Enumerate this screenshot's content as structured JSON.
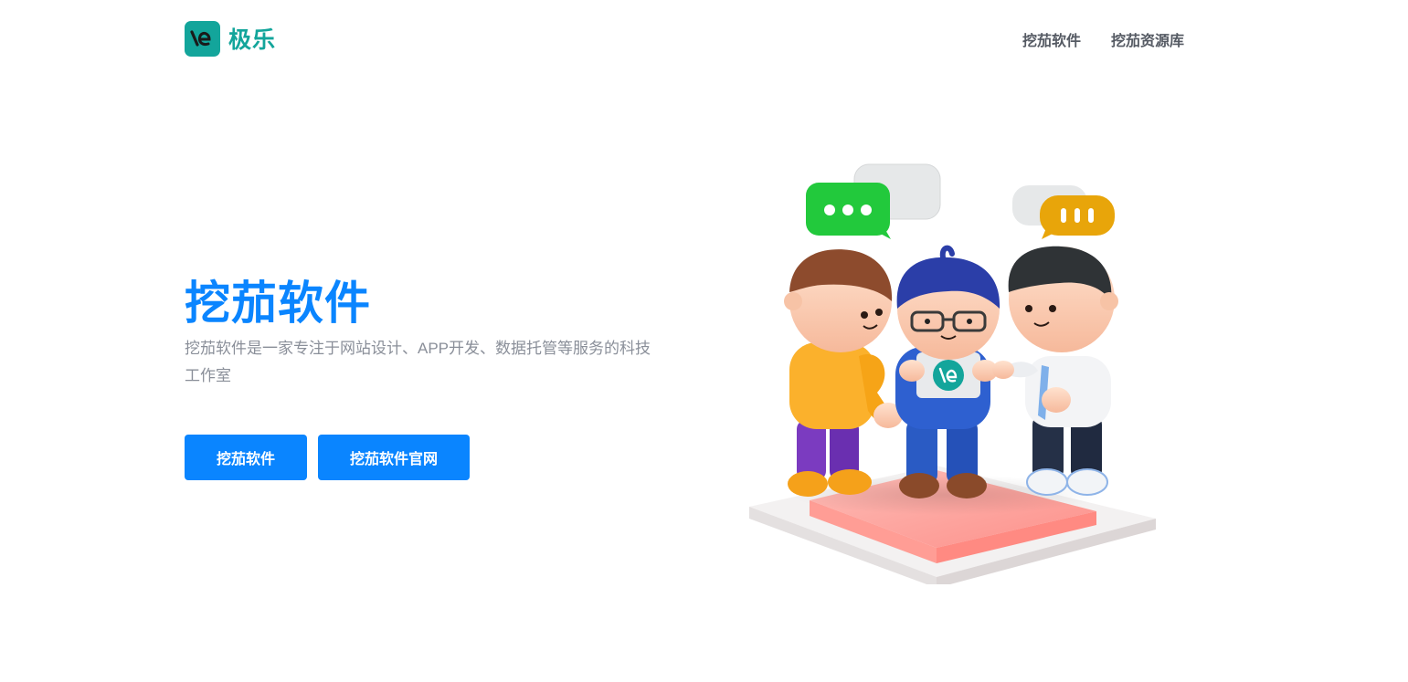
{
  "header": {
    "brand": {
      "name": "极乐",
      "logo_icon": "le-logo-icon",
      "color": "#13a59b"
    },
    "nav": [
      {
        "label": "挖茄软件"
      },
      {
        "label": "挖茄资源库"
      }
    ]
  },
  "hero": {
    "title": "挖茄软件",
    "description": "挖茄软件是一家专注于网站设计、APP开发、数据托管等服务的科技工作室",
    "buttons": [
      {
        "label": "挖茄软件"
      },
      {
        "label": "挖茄软件官网"
      }
    ],
    "illustration_icon": "team-collaboration-illustration"
  },
  "colors": {
    "accent": "#0a85ff",
    "brand": "#13a59b",
    "chat_green": "#22c93c",
    "chat_yellow": "#e8a50a",
    "platform_pink": "#ff8f86"
  }
}
